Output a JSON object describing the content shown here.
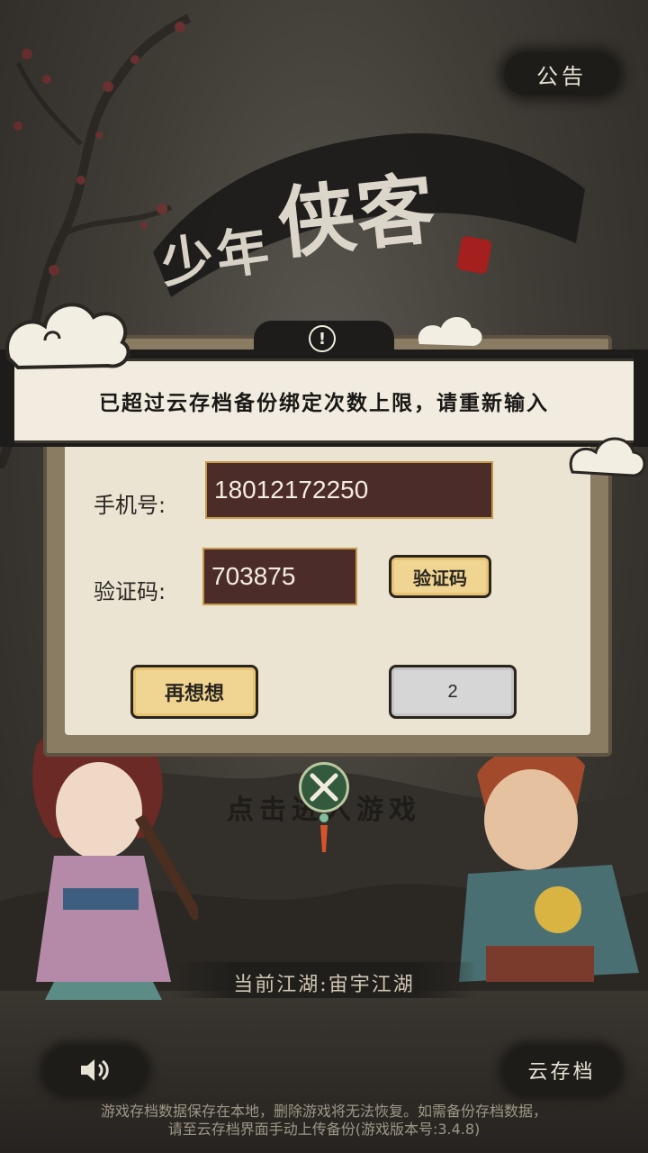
{
  "notice_button": "公告",
  "title": {
    "small": "少年",
    "big": "侠客"
  },
  "alert": {
    "message": "已超过云存档备份绑定次数上限，请重新输入"
  },
  "form": {
    "phone_label": "手机号:",
    "phone_value": "18012172250",
    "code_label": "验证码:",
    "code_value": "703875",
    "get_code_button": "验证码",
    "reconsider_button": "再想想",
    "confirm_button_countdown": "2"
  },
  "enter_game": "点击进入游戏",
  "current_jianghu": "当前江湖:宙宇江湖",
  "cloud_save_button": "云存档",
  "footer": {
    "line1": "游戏存档数据保存在本地，删除游戏将无法恢复。如需备份存档数据，",
    "line2": "请至云存档界面手动上传备份(游戏版本号:3.4.8)"
  },
  "icons": {
    "alert": "exclamation-icon",
    "sound": "speaker-icon",
    "close": "crossed-swords-icon"
  },
  "colors": {
    "input_bg": "#4c2c28",
    "button_gold": "#f0d592",
    "panel_paper": "#ebe4d2",
    "seal_red": "#a3201f"
  }
}
